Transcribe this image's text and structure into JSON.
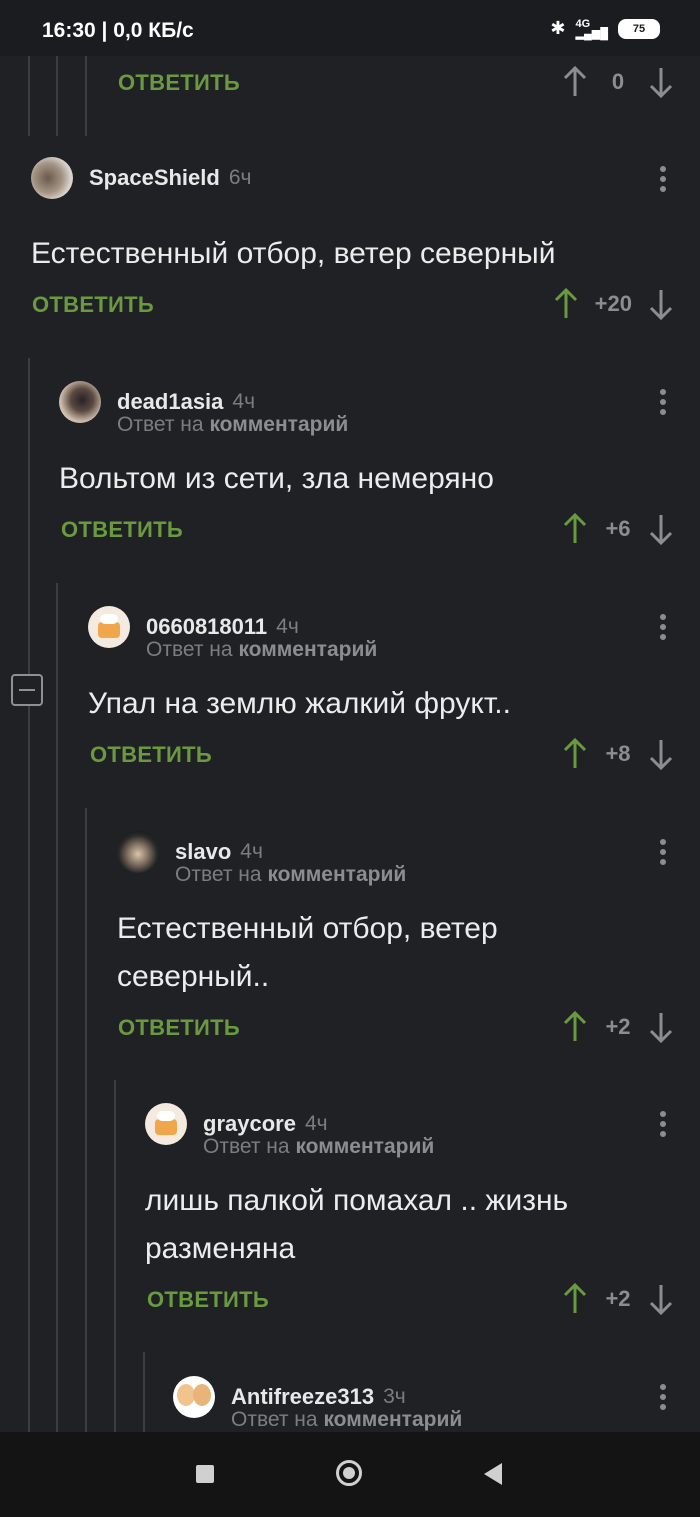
{
  "status": {
    "time": "16:30",
    "speed": "0,0 КБ/с",
    "network": "4G",
    "battery": "75"
  },
  "ui": {
    "reply_label": "ОТВЕТИТЬ",
    "reply_prefix": "Ответ на",
    "reply_target": "комментарий"
  },
  "top_partial": {
    "score": "0"
  },
  "comments": [
    {
      "user": "SpaceShield",
      "time": "6ч",
      "text": "Естественный отбор, ветер северный",
      "score": "+20",
      "is_reply": false
    },
    {
      "user": "dead1asia",
      "time": "4ч",
      "text": "Вольтом из сети, зла немеряно",
      "score": "+6",
      "is_reply": true
    },
    {
      "user": "0660818011",
      "time": "4ч",
      "text": "Упал на землю жалкий фрукт..",
      "score": "+8",
      "is_reply": true
    },
    {
      "user": "slavo",
      "time": "4ч",
      "text": "Естественный отбор, ветер северный..",
      "score": "+2",
      "is_reply": true
    },
    {
      "user": "graycore",
      "time": "4ч",
      "text": "лишь палкой помахал .. жизнь разменяна",
      "score": "+2",
      "is_reply": true
    },
    {
      "user": "Antifreeze313",
      "time": "3ч",
      "text": "",
      "score": "",
      "is_reply": true
    }
  ],
  "colors": {
    "background": "#1f2125",
    "reply_green": "#6a9a3f",
    "upvote_green": "#6a9a3f",
    "muted": "#7a7d82"
  }
}
